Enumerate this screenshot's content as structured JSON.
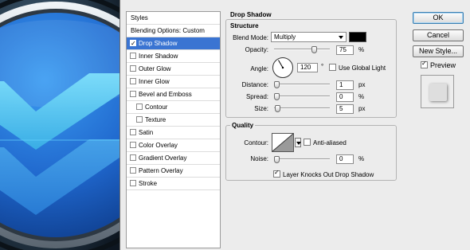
{
  "dialog": {
    "styles_header": "Styles",
    "blending_options": "Blending Options: Custom",
    "styles": [
      {
        "label": "Drop Shadow",
        "checked": true,
        "selected": true,
        "sub": false
      },
      {
        "label": "Inner Shadow",
        "checked": false,
        "selected": false,
        "sub": false
      },
      {
        "label": "Outer Glow",
        "checked": false,
        "selected": false,
        "sub": false
      },
      {
        "label": "Inner Glow",
        "checked": false,
        "selected": false,
        "sub": false
      },
      {
        "label": "Bevel and Emboss",
        "checked": false,
        "selected": false,
        "sub": false
      },
      {
        "label": "Contour",
        "checked": false,
        "selected": false,
        "sub": true
      },
      {
        "label": "Texture",
        "checked": false,
        "selected": false,
        "sub": true
      },
      {
        "label": "Satin",
        "checked": false,
        "selected": false,
        "sub": false
      },
      {
        "label": "Color Overlay",
        "checked": false,
        "selected": false,
        "sub": false
      },
      {
        "label": "Gradient Overlay",
        "checked": false,
        "selected": false,
        "sub": false
      },
      {
        "label": "Pattern Overlay",
        "checked": false,
        "selected": false,
        "sub": false
      },
      {
        "label": "Stroke",
        "checked": false,
        "selected": false,
        "sub": false
      }
    ],
    "section_title": "Drop Shadow",
    "structure": {
      "title": "Structure",
      "blend_mode_label": "Blend Mode:",
      "blend_mode_value": "Multiply",
      "shadow_color": "#000000",
      "opacity_label": "Opacity:",
      "opacity_value": "75",
      "opacity_unit": "%",
      "opacity_fraction": 0.75,
      "angle_label": "Angle:",
      "angle_value": "120",
      "angle_unit": "°",
      "use_global_light_label": "Use Global Light",
      "use_global_light": false,
      "distance_label": "Distance:",
      "distance_value": "1",
      "distance_unit": "px",
      "distance_fraction": 0.0,
      "spread_label": "Spread:",
      "spread_value": "0",
      "spread_unit": "%",
      "spread_fraction": 0.0,
      "size_label": "Size:",
      "size_value": "5",
      "size_unit": "px",
      "size_fraction": 0.02
    },
    "quality": {
      "title": "Quality",
      "contour_label": "Contour:",
      "anti_aliased_label": "Anti-aliased",
      "anti_aliased": false,
      "noise_label": "Noise:",
      "noise_value": "0",
      "noise_unit": "%",
      "noise_fraction": 0.0,
      "layer_knocks_out_label": "Layer Knocks Out Drop Shadow",
      "layer_knocks_out": true
    },
    "buttons": {
      "ok": "OK",
      "cancel": "Cancel",
      "new_style": "New Style...",
      "preview_label": "Preview",
      "preview": true
    },
    "colors": {
      "selection": "#3a74d2",
      "icon_blue": "#2b7de0",
      "chevron_cyan": "#54c4f0"
    }
  }
}
